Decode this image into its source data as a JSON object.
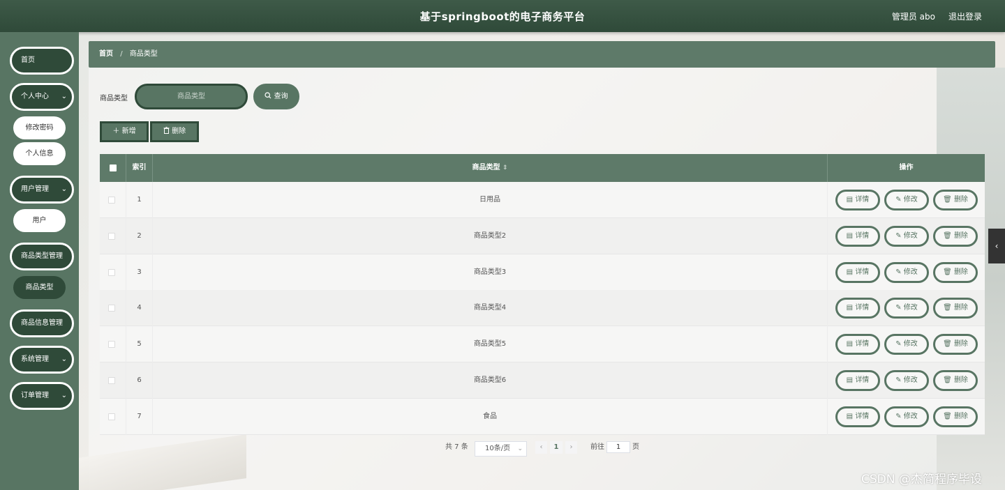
{
  "header": {
    "title": "基于springboot的电子商务平台",
    "user": "管理员 abo",
    "logout": "退出登录"
  },
  "sidebar": {
    "home": "首页",
    "personal_center": "个人中心",
    "change_password": "修改密码",
    "personal_info": "个人信息",
    "user_management": "用户管理",
    "user": "用户",
    "category_management": "商品类型管理",
    "category": "商品类型",
    "product_management": "商品信息管理",
    "system_management": "系统管理",
    "order_management": "订单管理",
    "chevron": "⌄"
  },
  "breadcrumb": {
    "home": "首页",
    "separator": "/",
    "current": "商品类型"
  },
  "search": {
    "label": "商品类型",
    "placeholder": "商品类型",
    "button": "查询",
    "search_icon": "search-icon"
  },
  "toolbar": {
    "add": "＋ 新增",
    "delete": "删除"
  },
  "table": {
    "columns": {
      "index": "索引",
      "category": "商品类型",
      "sort_icon": "⇕",
      "actions": "操作"
    },
    "rows": [
      {
        "index": "1",
        "category": "日用品"
      },
      {
        "index": "2",
        "category": "商品类型2"
      },
      {
        "index": "3",
        "category": "商品类型3"
      },
      {
        "index": "4",
        "category": "商品类型4"
      },
      {
        "index": "5",
        "category": "商品类型5"
      },
      {
        "index": "6",
        "category": "商品类型6"
      },
      {
        "index": "7",
        "category": "食品"
      }
    ],
    "actions": {
      "detail": "详情",
      "edit": "修改",
      "delete": "删除"
    }
  },
  "pagination": {
    "total": "共 7 条",
    "page_size": "10条/页",
    "current_page": "1",
    "goto_label": "前往",
    "goto_value": "1",
    "page_suffix": "页",
    "prev": "‹",
    "next": "›"
  },
  "watermark": "CSDN @杰简程序毕设",
  "colors": {
    "primary": "#587563",
    "dark": "#2f4a39",
    "header": "#3e5a48"
  }
}
